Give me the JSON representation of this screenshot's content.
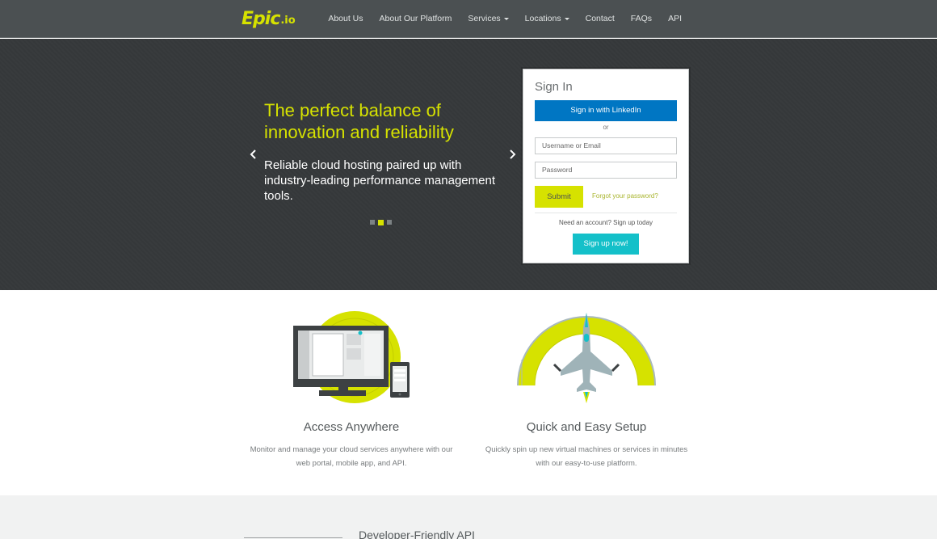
{
  "brand": {
    "logo_main": "Epic",
    "logo_sub": ".io",
    "accent": "#d6e200"
  },
  "nav": {
    "items": [
      {
        "label": "About Us",
        "dropdown": false
      },
      {
        "label": "About Our Platform",
        "dropdown": false
      },
      {
        "label": "Services",
        "dropdown": true
      },
      {
        "label": "Locations",
        "dropdown": true
      },
      {
        "label": "Contact",
        "dropdown": false
      },
      {
        "label": "FAQs",
        "dropdown": false
      },
      {
        "label": "API",
        "dropdown": false
      }
    ]
  },
  "hero": {
    "title": "The perfect balance of innovation and reliability",
    "text": "Reliable cloud hosting paired up with industry-leading performance management tools.",
    "prev_icon": "chevron-left-icon",
    "next_icon": "chevron-right-icon",
    "slide_count": 3,
    "active_slide": 2
  },
  "signin": {
    "title": "Sign In",
    "linkedin_label": "Sign in with LinkedIn",
    "or_text": "or",
    "username_placeholder": "Username or Email",
    "password_placeholder": "Password",
    "submit_label": "Submit",
    "forgot_label": "Forgot your password?",
    "need_account": "Need an account? Sign up today",
    "signup_label": "Sign up now!",
    "linkedin_color": "#0076c3",
    "signup_color": "#14c0c9"
  },
  "features": [
    {
      "icon": "devices-icon",
      "title": "Access Anywhere",
      "desc_line1": "Monitor and manage your cloud services anywhere with our",
      "desc_line2": "web portal, mobile app, and API."
    },
    {
      "icon": "jet-gauge-icon",
      "title": "Quick and Easy Setup",
      "desc_line1": "Quickly spin up new virtual machines or services in minutes",
      "desc_line2": "with our easy-to-use platform."
    }
  ],
  "bottom": {
    "title": "Developer-Friendly API"
  }
}
